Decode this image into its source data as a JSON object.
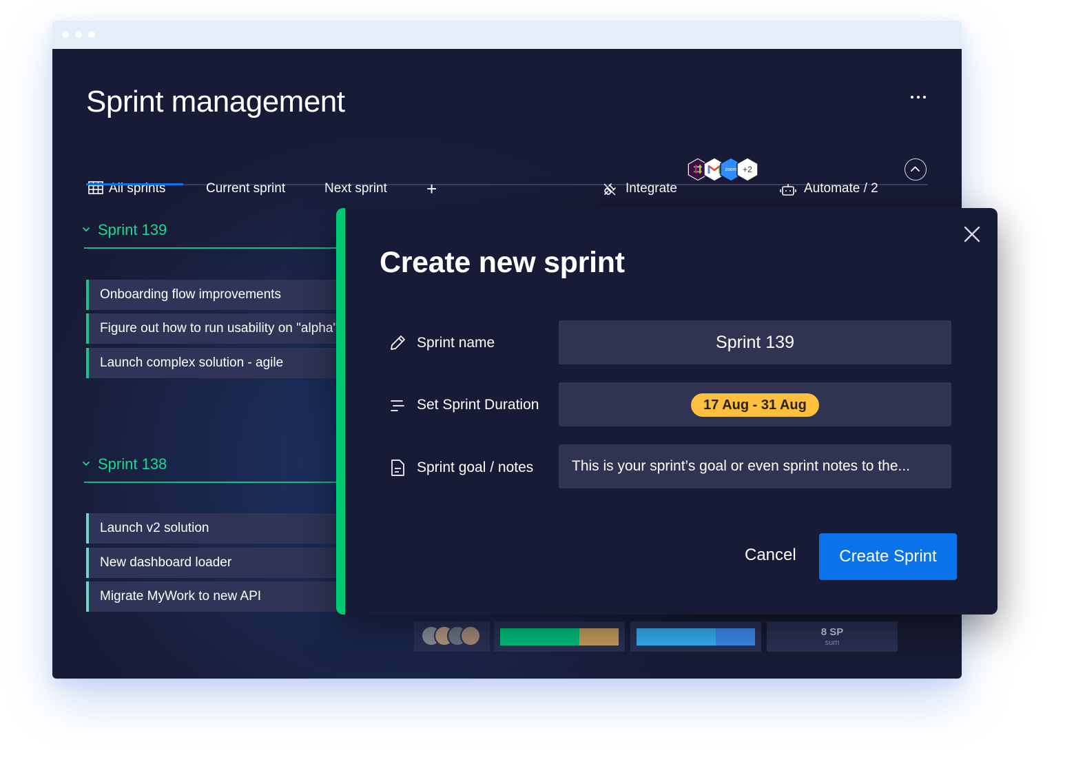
{
  "page": {
    "title": "Sprint management",
    "more_icon": "more-horizontal-icon"
  },
  "tabs": [
    {
      "label": "All sprints",
      "icon": "table-grid-icon",
      "active": true
    },
    {
      "label": "Current sprint",
      "active": false
    },
    {
      "label": "Next sprint",
      "active": false
    }
  ],
  "tab_add_label": "+",
  "toolbar": {
    "integrate_label": "Integrate",
    "integrate_icon": "plug-icon",
    "integration_apps": [
      "slack-icon",
      "gmail-icon",
      "zoom-icon"
    ],
    "zoom_text": "zoom",
    "more_integrations": "+2",
    "automate_label": "Automate / 2",
    "automate_icon": "robot-icon",
    "collapse_icon": "chevron-up-icon"
  },
  "groups": [
    {
      "name": "Sprint 139",
      "color": "#00c875",
      "items": [
        "Onboarding flow improvements",
        "Figure out how to run usability on \"alpha\"",
        "Launch complex solution - agile"
      ]
    },
    {
      "name": "Sprint 138",
      "color": "#6cd9c7",
      "items": [
        "Launch v2 solution",
        "New dashboard loader",
        "Migrate MyWork to new API"
      ]
    }
  ],
  "summary": {
    "avatars": 4,
    "status_bar_1": {
      "segments": [
        {
          "share": 0.67,
          "color": "#00c281"
        },
        {
          "share": 0.33,
          "color": "#c9a05f"
        }
      ]
    },
    "status_bar_2": {
      "segments": [
        {
          "share": 0.67,
          "color": "#38b1f8"
        },
        {
          "share": 0.33,
          "color": "#3d8ff3"
        }
      ]
    },
    "story_points": "8 SP",
    "story_points_sub": "sum"
  },
  "modal": {
    "title": "Create new sprint",
    "close_icon": "close-icon",
    "fields": [
      {
        "icon": "pencil-icon",
        "label": "Sprint name",
        "value": "Sprint 139"
      },
      {
        "icon": "duration-lines-icon",
        "label": "Set Sprint Duration",
        "value": "17 Aug - 31 Aug",
        "pill_color": "#fdbf3e"
      },
      {
        "icon": "document-icon",
        "label": "Sprint goal / notes",
        "value": "This is your sprint’s goal or even sprint notes to the..."
      }
    ],
    "cancel_label": "Cancel",
    "create_label": "Create Sprint",
    "accent_color": "#0a73eb"
  }
}
